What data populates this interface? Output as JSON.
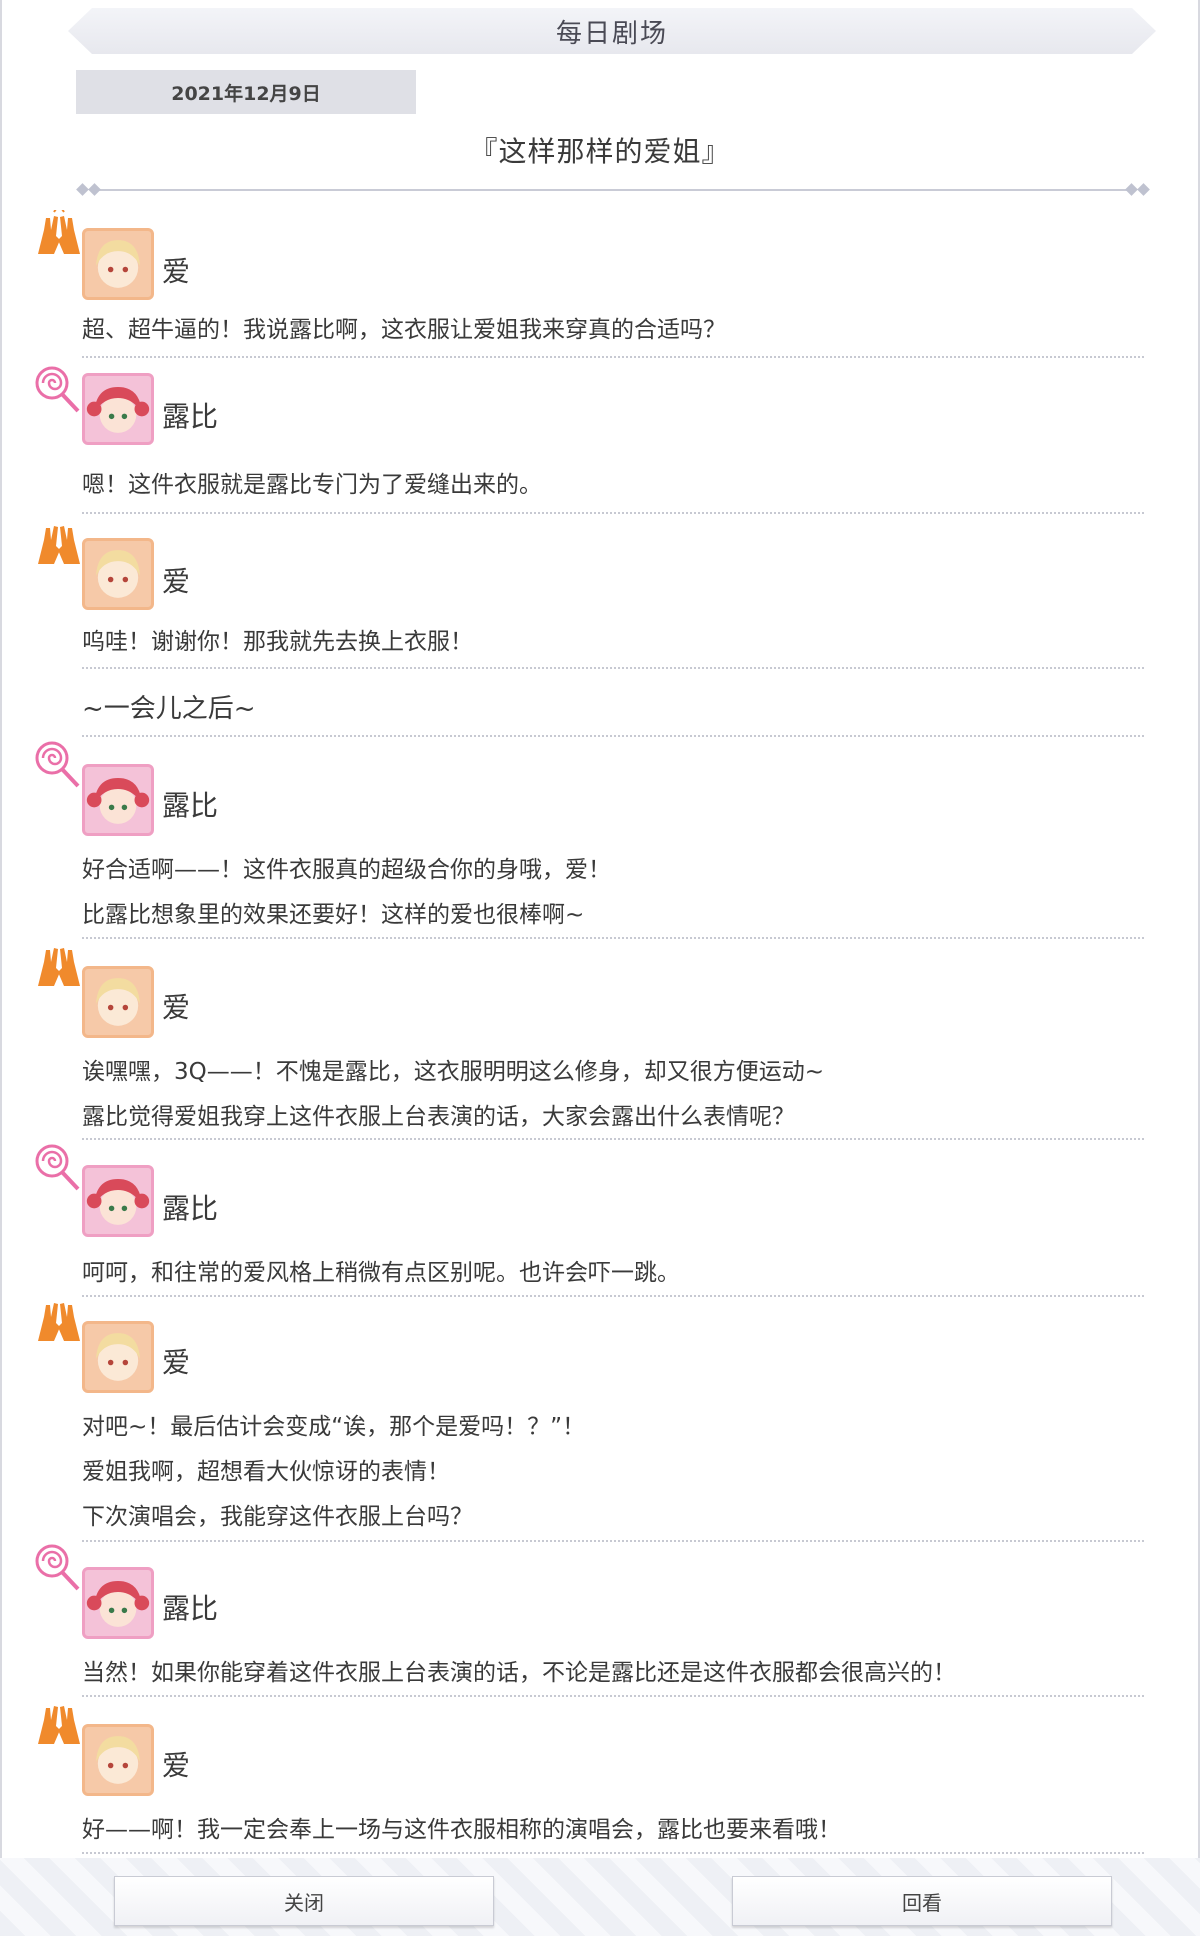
{
  "header": {
    "title": "每日剧场"
  },
  "date": "2021年12月9日",
  "story_title": "『这样那样的爱姐』",
  "dialogue": [
    {
      "speaker": "爱",
      "lines": [
        "超、超牛逼的！我说露比啊，这衣服让爱姐我来穿真的合适吗？"
      ]
    },
    {
      "speaker": "露比",
      "lines": [
        "嗯！这件衣服就是露比专门为了爱缝出来的。"
      ]
    },
    {
      "speaker": "爱",
      "lines": [
        "呜哇！谢谢你！那我就先去换上衣服！"
      ]
    },
    {
      "aside": "~一会儿之后~"
    },
    {
      "speaker": "露比",
      "lines": [
        "好合适啊——！这件衣服真的超级合你的身哦，爱！",
        "比露比想象里的效果还要好！这样的爱也很棒啊~"
      ]
    },
    {
      "speaker": "爱",
      "lines": [
        "诶嘿嘿，3Q——！不愧是露比，这衣服明明这么修身，却又很方便运动~",
        "露比觉得爱姐我穿上这件衣服上台表演的话，大家会露出什么表情呢？"
      ]
    },
    {
      "speaker": "露比",
      "lines": [
        "呵呵，和往常的爱风格上稍微有点区别呢。也许会吓一跳。"
      ]
    },
    {
      "speaker": "爱",
      "lines": [
        "对吧~！最后估计会变成“诶，那个是爱吗！？”！",
        "爱姐我啊，超想看大伙惊讶的表情！",
        "下次演唱会，我能穿这件衣服上台吗？"
      ]
    },
    {
      "speaker": "露比",
      "lines": [
        "当然！如果你能穿着这件衣服上台表演的话，不论是露比还是这件衣服都会很高兴的！"
      ]
    },
    {
      "speaker": "爱",
      "lines": [
        "好——啊！我一定会奉上一场与这件衣服相称的演唱会，露比也要来看哦！"
      ]
    }
  ],
  "buttons": {
    "close": "关闭",
    "replay": "回看"
  },
  "colors": {
    "ai_accent": "#f08a2c",
    "rubi_accent": "#ea6fa8",
    "divider": "#c7c9d2"
  },
  "icons": {
    "ai_badge": "high-five-hands-icon",
    "rubi_badge": "lollipop-icon"
  }
}
